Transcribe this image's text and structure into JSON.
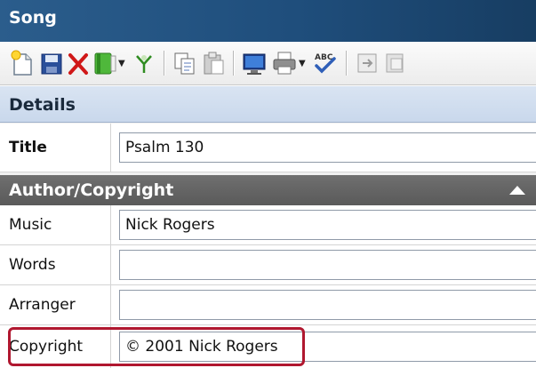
{
  "window": {
    "title": "Song"
  },
  "toolbar": {
    "icons": [
      "new-document-icon",
      "save-icon",
      "delete-icon",
      "add-book-icon",
      "filter-icon",
      "copy-icon",
      "paste-icon",
      "present-icon",
      "print-icon",
      "spellcheck-icon",
      "export-icon",
      "import-icon"
    ],
    "spellcheck_text": "ABC"
  },
  "details": {
    "header": "Details",
    "title_label": "Title",
    "title_value": "Psalm 130"
  },
  "author": {
    "header": "Author/Copyright",
    "music_label": "Music",
    "music_value": "Nick Rogers",
    "words_label": "Words",
    "words_value": "",
    "arranger_label": "Arranger",
    "arranger_value": "",
    "copyright_label": "Copyright",
    "copyright_value": "© 2001 Nick Rogers"
  },
  "colors": {
    "titlebar": "#1f4e7c",
    "details_header": "#ccd9ec",
    "author_header": "#636363",
    "highlight": "#b0172f"
  }
}
